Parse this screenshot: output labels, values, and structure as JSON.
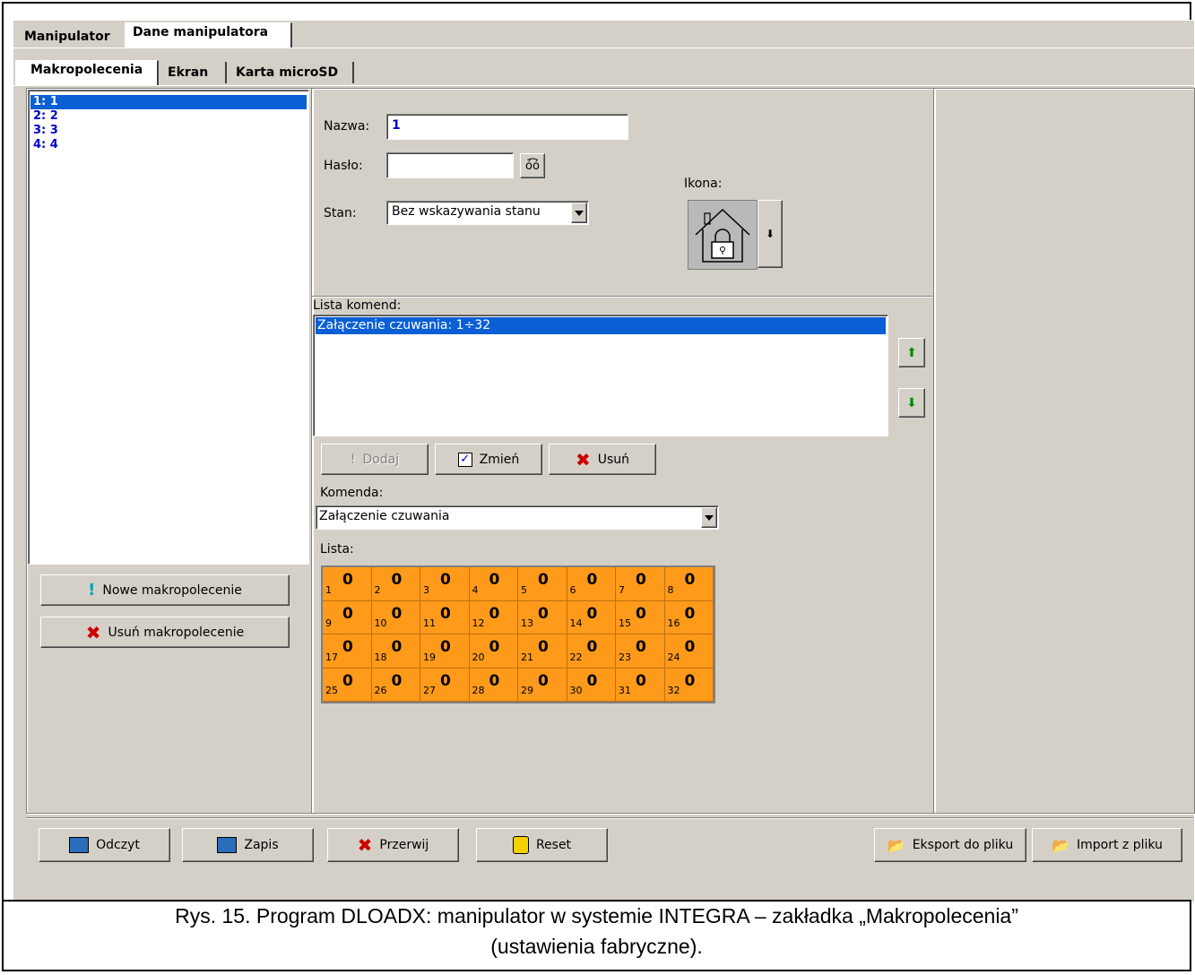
{
  "tabs_top": [
    "Manipulator",
    "Dane manipulatora"
  ],
  "tabs_sub": [
    "Makropolecenia",
    "Ekran",
    "Karta microSD"
  ],
  "macros": [
    "1: 1",
    "2: 2",
    "3: 3",
    "4: 4"
  ],
  "buttons_left": {
    "new": "Nowe makropolecenie",
    "remove": "Usuń makropolecenie"
  },
  "form": {
    "name_label": "Nazwa:",
    "name_value": "1",
    "password_label": "Hasło:",
    "password_value": "",
    "state_label": "Stan:",
    "state_value": "Bez wskazywania stanu",
    "icon_label": "Ikona:"
  },
  "commands": {
    "label": "Lista komend:",
    "items": [
      "Załączenie czuwania: 1÷32"
    ],
    "add": "Dodaj",
    "change": "Zmień",
    "delete": "Usuń",
    "command_label": "Komenda:",
    "command_value": "Załączenie czuwania",
    "list_label": "Lista:"
  },
  "grid_cells": [
    {
      "n": "1",
      "v": "0"
    },
    {
      "n": "2",
      "v": "0"
    },
    {
      "n": "3",
      "v": "0"
    },
    {
      "n": "4",
      "v": "0"
    },
    {
      "n": "5",
      "v": "0"
    },
    {
      "n": "6",
      "v": "0"
    },
    {
      "n": "7",
      "v": "0"
    },
    {
      "n": "8",
      "v": "0"
    },
    {
      "n": "9",
      "v": "0"
    },
    {
      "n": "10",
      "v": "0"
    },
    {
      "n": "11",
      "v": "0"
    },
    {
      "n": "12",
      "v": "0"
    },
    {
      "n": "13",
      "v": "0"
    },
    {
      "n": "14",
      "v": "0"
    },
    {
      "n": "15",
      "v": "0"
    },
    {
      "n": "16",
      "v": "0"
    },
    {
      "n": "17",
      "v": "0"
    },
    {
      "n": "18",
      "v": "0"
    },
    {
      "n": "19",
      "v": "0"
    },
    {
      "n": "20",
      "v": "0"
    },
    {
      "n": "21",
      "v": "0"
    },
    {
      "n": "22",
      "v": "0"
    },
    {
      "n": "23",
      "v": "0"
    },
    {
      "n": "24",
      "v": "0"
    },
    {
      "n": "25",
      "v": "0"
    },
    {
      "n": "26",
      "v": "0"
    },
    {
      "n": "27",
      "v": "0"
    },
    {
      "n": "28",
      "v": "0"
    },
    {
      "n": "29",
      "v": "0"
    },
    {
      "n": "30",
      "v": "0"
    },
    {
      "n": "31",
      "v": "0"
    },
    {
      "n": "32",
      "v": "0"
    }
  ],
  "bottom": {
    "read": "Odczyt",
    "write": "Zapis",
    "stop": "Przerwij",
    "reset": "Reset",
    "export": "Eksport do pliku",
    "import": "Import z pliku"
  },
  "caption": {
    "line1": "Rys. 15. Program DLOADX: manipulator w systemie INTEGRA – zakładka „Makropolecenia”",
    "line2": "(ustawienia fabryczne)."
  },
  "colors": {
    "selection": "#0a5fd4",
    "grid": "#ff9a1a",
    "window": "#d4d0c8"
  }
}
